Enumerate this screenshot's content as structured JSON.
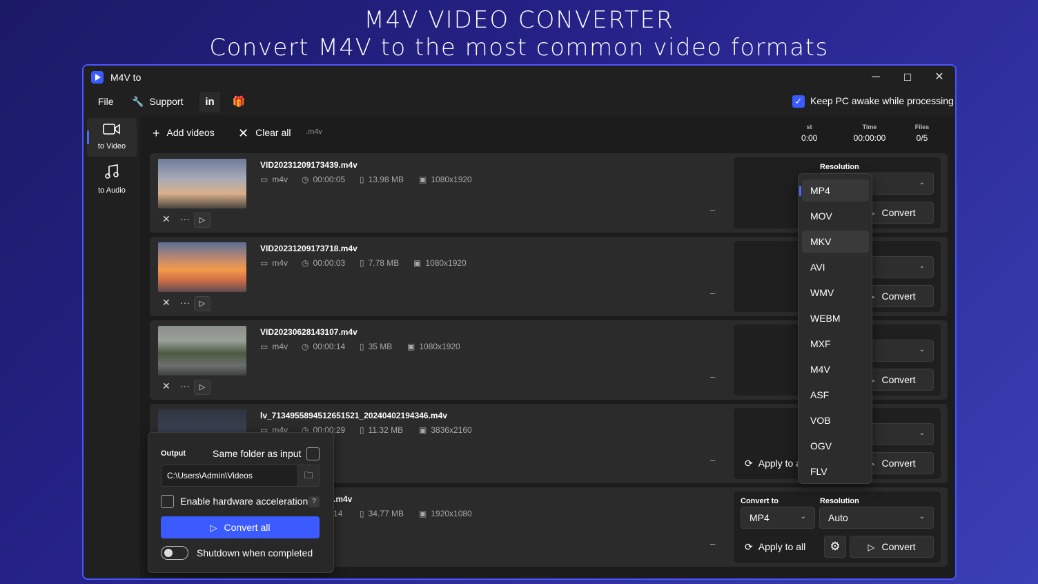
{
  "banner": {
    "line1": "M4V VIDEO CONVERTER",
    "line2": "Convert M4V to the most common video formats"
  },
  "window": {
    "title": "M4V to",
    "controls": {
      "minimize": "─",
      "maximize": "☐",
      "close": "✕"
    }
  },
  "menu": {
    "file": "File",
    "support": "Support",
    "linkedin": "in",
    "keep_awake": "Keep PC awake while processing",
    "keep_awake_checked": true
  },
  "sidebar": {
    "items": [
      {
        "label": "to Video",
        "icon": "video-camera-icon",
        "active": true
      },
      {
        "label": "to Audio",
        "icon": "music-note-icon",
        "active": false
      }
    ]
  },
  "toolbar": {
    "add_videos": "Add videos",
    "clear_all": "Clear all",
    "ext": ".m4v"
  },
  "stats": {
    "time_label": "Time",
    "time_value": "00:00:00",
    "files_label": "Files",
    "files_value": "0/5",
    "partial_label": "st",
    "partial_value": "0:00"
  },
  "files": [
    {
      "name": "VID20231209173439.m4v",
      "format": "m4v",
      "duration": "00:00:05",
      "size": "13.98 MB",
      "resolution": "1080x1920",
      "thumb": "sky-sunset"
    },
    {
      "name": "VID20231209173718.m4v",
      "format": "m4v",
      "duration": "00:00:03",
      "size": "7.78 MB",
      "resolution": "1080x1920",
      "thumb": "sunset-clouds"
    },
    {
      "name": "VID20230628143107.m4v",
      "format": "m4v",
      "duration": "00:00:14",
      "size": "35 MB",
      "resolution": "1080x1920",
      "thumb": "rainy-street"
    },
    {
      "name": "lv_7134955894512651521_20240402194346.m4v",
      "format": "m4v",
      "duration": "00:00:29",
      "size": "11.32 MB",
      "resolution": "3836x2160",
      "thumb": "screen-recording"
    },
    {
      "name": ".m4v",
      "format": "m4v",
      "duration": "14",
      "size": "34.77 MB",
      "resolution": "1920x1080",
      "thumb": "hidden"
    }
  ],
  "row_panel": {
    "convert_to_label": "Convert to",
    "convert_to_value": "MP4",
    "resolution_label": "Resolution",
    "resolution_value": "Auto",
    "apply_to_all": "Apply to all",
    "convert": "Convert"
  },
  "format_dropdown": {
    "options": [
      "MP4",
      "MOV",
      "MKV",
      "AVI",
      "WMV",
      "WEBM",
      "MXF",
      "M4V",
      "ASF",
      "VOB",
      "OGV",
      "FLV"
    ],
    "selected": "MP4",
    "hovered": "MKV"
  },
  "output": {
    "label": "Output",
    "same_folder": "Same folder as input",
    "path": "C:\\Users\\Admin\\Videos",
    "hw_accel": "Enable hardware acceleration",
    "help": "?",
    "convert_all": "Convert all",
    "shutdown": "Shutdown when completed"
  },
  "colors": {
    "accent": "#3b5bff",
    "window_bg": "#202020",
    "row_bg": "#2b2b2b"
  }
}
